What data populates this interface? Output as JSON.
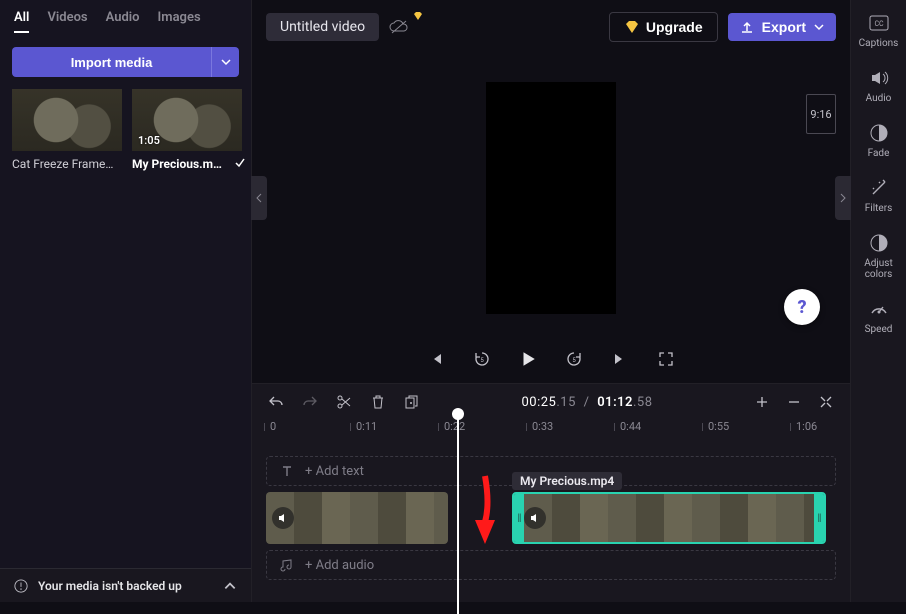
{
  "tabs": {
    "all": "All",
    "videos": "Videos",
    "audio": "Audio",
    "images": "Images"
  },
  "import": {
    "label": "Import media"
  },
  "media": [
    {
      "label": "Cat Freeze Frame…",
      "duration": ""
    },
    {
      "label": "My Precious.m…",
      "duration": "1:05"
    }
  ],
  "backup": {
    "text": "Your media isn't backed up"
  },
  "project": {
    "title": "Untitled video"
  },
  "upgrade": {
    "label": "Upgrade"
  },
  "export": {
    "label": "Export"
  },
  "aspect": {
    "label": "9:16"
  },
  "help": {
    "symbol": "?"
  },
  "time": {
    "current": "00:25",
    "current_frac": ".15",
    "total": "01:12",
    "total_frac": ".58"
  },
  "ruler": [
    "0",
    "0:11",
    "0:22",
    "0:33",
    "0:44",
    "0:55",
    "1:06"
  ],
  "tracks": {
    "text": "+ Add text",
    "audio": "+ Add audio",
    "clip_label": "My Precious.mp4"
  },
  "rail": {
    "captions": "Captions",
    "audio": "Audio",
    "fade": "Fade",
    "filters": "Filters",
    "adjust": "Adjust colors",
    "speed": "Speed"
  }
}
